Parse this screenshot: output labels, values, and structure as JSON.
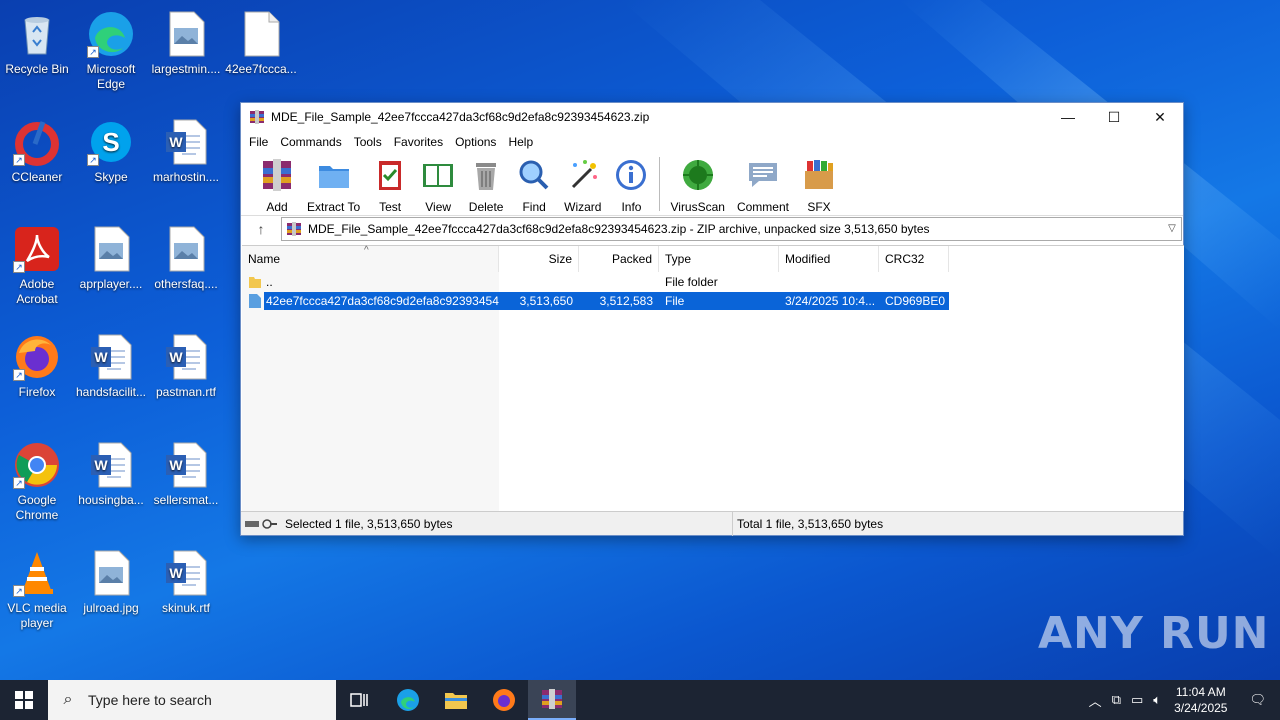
{
  "desktop": {
    "icons": [
      {
        "label": "Recycle Bin",
        "icon": "recycle-bin-icon"
      },
      {
        "label": "Microsoft Edge",
        "icon": "edge-icon"
      },
      {
        "label": "largestmin....",
        "icon": "image-file-icon"
      },
      {
        "label": "42ee7fccca...",
        "icon": "blank-file-icon"
      },
      {
        "label": "CCleaner",
        "icon": "ccleaner-icon"
      },
      {
        "label": "Skype",
        "icon": "skype-icon"
      },
      {
        "label": "marhostin....",
        "icon": "word-doc-icon"
      },
      {
        "label": "Adobe Acrobat",
        "icon": "acrobat-icon"
      },
      {
        "label": "aprplayer....",
        "icon": "image-file-icon"
      },
      {
        "label": "othersfaq....",
        "icon": "image-file-icon"
      },
      {
        "label": "Firefox",
        "icon": "firefox-icon"
      },
      {
        "label": "handsfacilit...",
        "icon": "word-doc-icon"
      },
      {
        "label": "pastman.rtf",
        "icon": "word-doc-icon"
      },
      {
        "label": "Google Chrome",
        "icon": "chrome-icon"
      },
      {
        "label": "housingba...",
        "icon": "word-doc-icon"
      },
      {
        "label": "sellersmat...",
        "icon": "word-doc-icon"
      },
      {
        "label": "VLC media player",
        "icon": "vlc-icon"
      },
      {
        "label": "julroad.jpg",
        "icon": "image-file-icon"
      },
      {
        "label": "skinuk.rtf",
        "icon": "word-doc-icon"
      }
    ]
  },
  "window": {
    "title": "MDE_File_Sample_42ee7fccca427da3cf68c9d2efa8c92393454623.zip",
    "controls": {
      "minimize": "—",
      "maximize": "☐",
      "close": "✕"
    },
    "menu": [
      "File",
      "Commands",
      "Tools",
      "Favorites",
      "Options",
      "Help"
    ],
    "toolbar": [
      "Add",
      "Extract To",
      "Test",
      "View",
      "Delete",
      "Find",
      "Wizard",
      "Info",
      "VirusScan",
      "Comment",
      "SFX"
    ],
    "address": "MDE_File_Sample_42ee7fccca427da3cf68c9d2efa8c92393454623.zip - ZIP archive, unpacked size 3,513,650 bytes",
    "columns": {
      "name": "Name",
      "size": "Size",
      "packed": "Packed",
      "type": "Type",
      "modified": "Modified",
      "crc": "CRC32"
    },
    "rows": [
      {
        "name": "..",
        "size": "",
        "packed": "",
        "type": "File folder",
        "modified": "",
        "crc": ""
      },
      {
        "name": "42ee7fccca427da3cf68c9d2efa8c92393454...",
        "size": "3,513,650",
        "packed": "3,512,583",
        "type": "File",
        "modified": "3/24/2025 10:4...",
        "crc": "CD969BE0"
      }
    ],
    "status_left": "Selected 1 file, 3,513,650 bytes",
    "status_right": "Total 1 file, 3,513,650 bytes"
  },
  "taskbar": {
    "search_placeholder": "Type here to search",
    "time": "11:04 AM",
    "date": "3/24/2025"
  },
  "watermark": "ANY RUN"
}
